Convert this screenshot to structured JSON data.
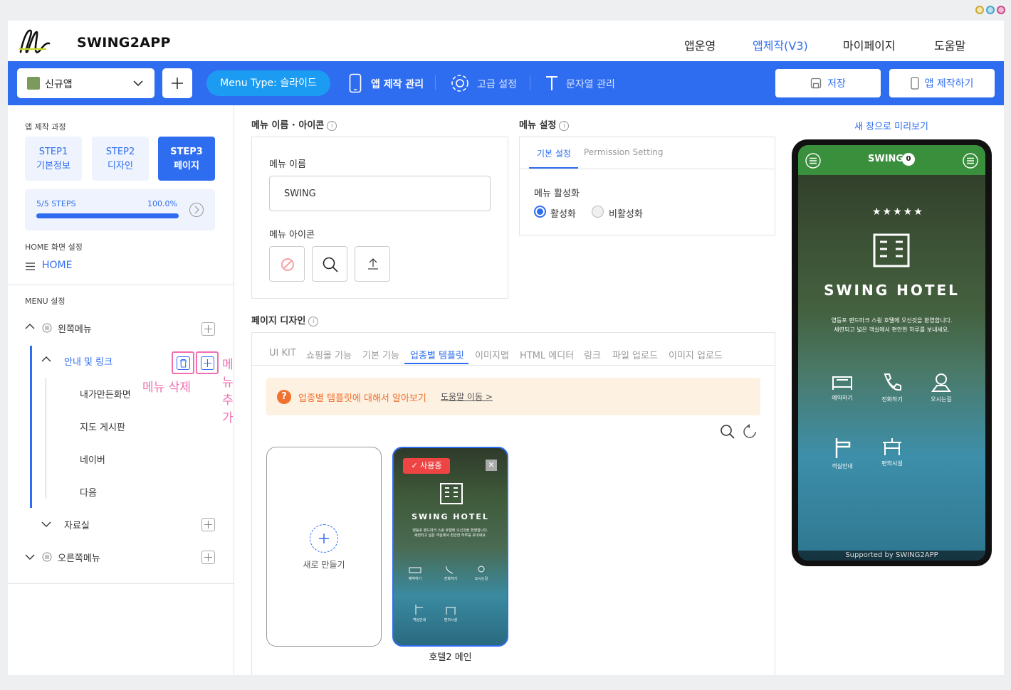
{
  "header": {
    "brand": "SWING2APP",
    "nav": [
      "앱운영",
      "앱제작(V3)",
      "마이페이지",
      "도움말"
    ]
  },
  "toolbar": {
    "app_name": "신규앱",
    "menu_type_label": "Menu Type:",
    "menu_type_value": "슬라이드",
    "app_manage": "앱 제작 관리",
    "advanced": "고급 설정",
    "strings": "문자열 관리",
    "save": "저장",
    "build": "앱 제작하기"
  },
  "sidebar": {
    "process_label": "앱 제작 과정",
    "steps": [
      {
        "line1": "STEP1",
        "line2": "기본정보"
      },
      {
        "line1": "STEP2",
        "line2": "디자인"
      },
      {
        "line1": "STEP3",
        "line2": "페이지"
      }
    ],
    "progress_steps": "5/5 STEPS",
    "progress_pct": "100.0%",
    "progress_value": 1.0,
    "home_label": "HOME 화면 설정",
    "home_item": "HOME",
    "menu_label": "MENU 설정",
    "left_menu": "왼쪽메뉴",
    "guide_links": "안내 및 링크",
    "children": [
      "내가만든화면",
      "지도 게시판",
      "네이버",
      "다음"
    ],
    "archive": "자료실",
    "right_menu": "오른쪽메뉴",
    "delete_hint": "메뉴 삭제",
    "add_hint": "메뉴 추가"
  },
  "menu_name_panel": {
    "title": "메뉴 이름 · 아이콘",
    "name_label": "메뉴 이름",
    "name_value": "SWING",
    "icon_label": "메뉴 아이콘"
  },
  "menu_settings": {
    "title": "메뉴 설정",
    "tab_basic": "기본 설정",
    "tab_permission": "Permission Setting",
    "activation_label": "메뉴 활성화",
    "active": "활성화",
    "inactive": "비활성화"
  },
  "page_design": {
    "title": "페이지 디자인",
    "tabs": [
      "UI KIT",
      "쇼핑몰 기능",
      "기본 기능",
      "업종별 템플릿",
      "이미지맵",
      "HTML 에디터",
      "링크",
      "파일 업로드",
      "이미지 업로드"
    ],
    "notice": "업종별 템플릿에 대해서 알아보기",
    "help_link": "도움말 이동",
    "new_card": "새로 만들기",
    "in_use": "사용중",
    "template_name": "호텔2 메인"
  },
  "preview": {
    "open_new": "새 창으로 미리보기",
    "app_title": "SWING",
    "badge": "0",
    "hotel_name": "SWING HOTEL",
    "desc1": "영등포 랜드마크 스윙 호텔에 오신것을 환영합니다.",
    "desc2": "세련되고 넓은 객실에서 편안한 하루를 보내세요.",
    "icons": [
      "예약하기",
      "전화하기",
      "오시는길",
      "객실안내",
      "편의시설"
    ],
    "footer": "Supported by SWING2APP"
  },
  "colors": {
    "primary": "#2f6df0",
    "pill": "#1b9cf2",
    "green": "#3a8f3c",
    "pink": "#f06fb1",
    "notice_bg": "#fdf1e2",
    "notice_text": "#f07130"
  }
}
